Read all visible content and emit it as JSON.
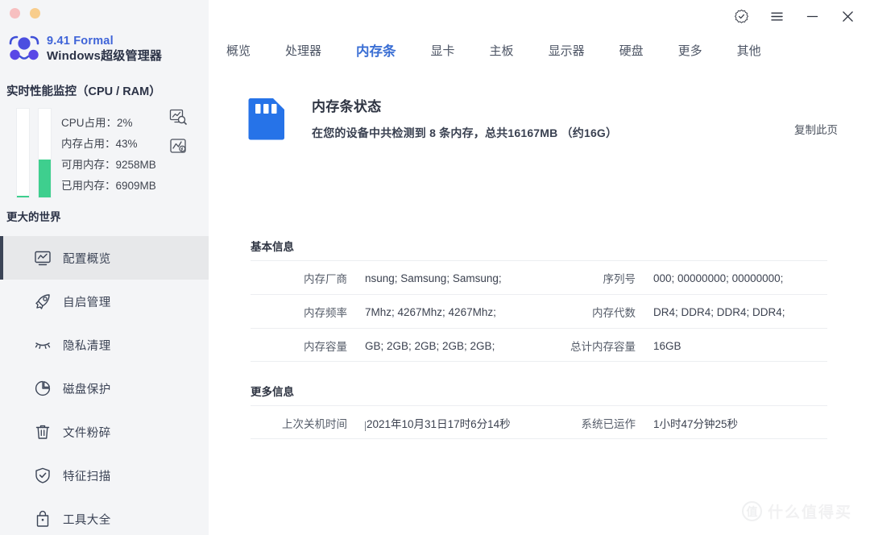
{
  "window": {
    "traffic_lights": [
      "close",
      "minimize"
    ],
    "controls": [
      {
        "name": "shield-check-icon",
        "label": "认证"
      },
      {
        "name": "hamburger-menu-icon",
        "label": "菜单"
      },
      {
        "name": "minimize-icon",
        "label": "最小化"
      },
      {
        "name": "close-icon",
        "label": "关闭"
      }
    ]
  },
  "sidebar": {
    "brand": {
      "version": "9.41 Formal",
      "name": "Windows超级管理器"
    },
    "performance": {
      "title": "实时性能监控（CPU / RAM）",
      "cpu_percent": 2,
      "ram_percent": 43,
      "rows": [
        {
          "label": "CPU占用：2%"
        },
        {
          "label": "内存占用：43%"
        },
        {
          "label": "可用内存：9258MB"
        },
        {
          "label": "已用内存：6909MB"
        }
      ],
      "icons": [
        {
          "name": "chart-search-icon"
        },
        {
          "name": "chart-boost-icon"
        }
      ]
    },
    "section_label": "更大的世界",
    "items": [
      {
        "label": "配置概览",
        "icon": "monitor-chart-icon",
        "active": true
      },
      {
        "label": "自启管理",
        "icon": "rocket-icon",
        "active": false
      },
      {
        "label": "隐私清理",
        "icon": "closed-eye-icon",
        "active": false
      },
      {
        "label": "磁盘保护",
        "icon": "pie-chart-icon",
        "active": false
      },
      {
        "label": "文件粉碎",
        "icon": "trash-icon",
        "active": false
      },
      {
        "label": "特征扫描",
        "icon": "shield-check-icon",
        "active": false
      },
      {
        "label": "工具大全",
        "icon": "bag-icon",
        "active": false
      }
    ]
  },
  "main": {
    "tabs": [
      {
        "label": "概览",
        "active": false
      },
      {
        "label": "处理器",
        "active": false
      },
      {
        "label": "内存条",
        "active": true
      },
      {
        "label": "显卡",
        "active": false
      },
      {
        "label": "主板",
        "active": false
      },
      {
        "label": "显示器",
        "active": false
      },
      {
        "label": "硬盘",
        "active": false
      },
      {
        "label": "更多",
        "active": false
      },
      {
        "label": "其他",
        "active": false
      }
    ],
    "hero": {
      "icon": "sd-card-icon",
      "title": "内存条状态",
      "subtitle": "在您的设备中共检测到 8 条内存，总共16167MB （约16G）",
      "copy_link": "复制此页"
    },
    "basic_info": {
      "title": "基本信息",
      "rows": [
        {
          "left": {
            "label": "内存厂商",
            "value": "nsung; Samsung; Samsung;"
          },
          "right": {
            "label": "序列号",
            "value": "000; 00000000; 00000000;"
          }
        },
        {
          "left": {
            "label": "内存频率",
            "value": "7Mhz; 4267Mhz; 4267Mhz;"
          },
          "right": {
            "label": "内存代数",
            "value": "DR4; DDR4; DDR4; DDR4;"
          }
        },
        {
          "left": {
            "label": "内存容量",
            "value": "GB; 2GB; 2GB; 2GB; 2GB;"
          },
          "right": {
            "label": "总计内存容量",
            "value": "16GB"
          }
        }
      ]
    },
    "more_info": {
      "title": "更多信息",
      "rows": [
        {
          "left": {
            "label": "上次关机时间",
            "value": "2021年10月31日17时6分14秒"
          },
          "right": {
            "label": "系统已运作",
            "value": "1小时47分钟25秒"
          }
        }
      ]
    }
  },
  "watermark": {
    "logo_char": "值",
    "text": "什么值得买"
  },
  "colors": {
    "accent_blue": "#3b6fd4",
    "brand_blue": "#3f64d8",
    "sd_card_blue": "#2673e8",
    "green_bar": "#3ecf8e",
    "sidebar_bg": "#f4f5f7",
    "active_row_bg": "#e7e8ea",
    "active_indicator": "#3b4456"
  }
}
